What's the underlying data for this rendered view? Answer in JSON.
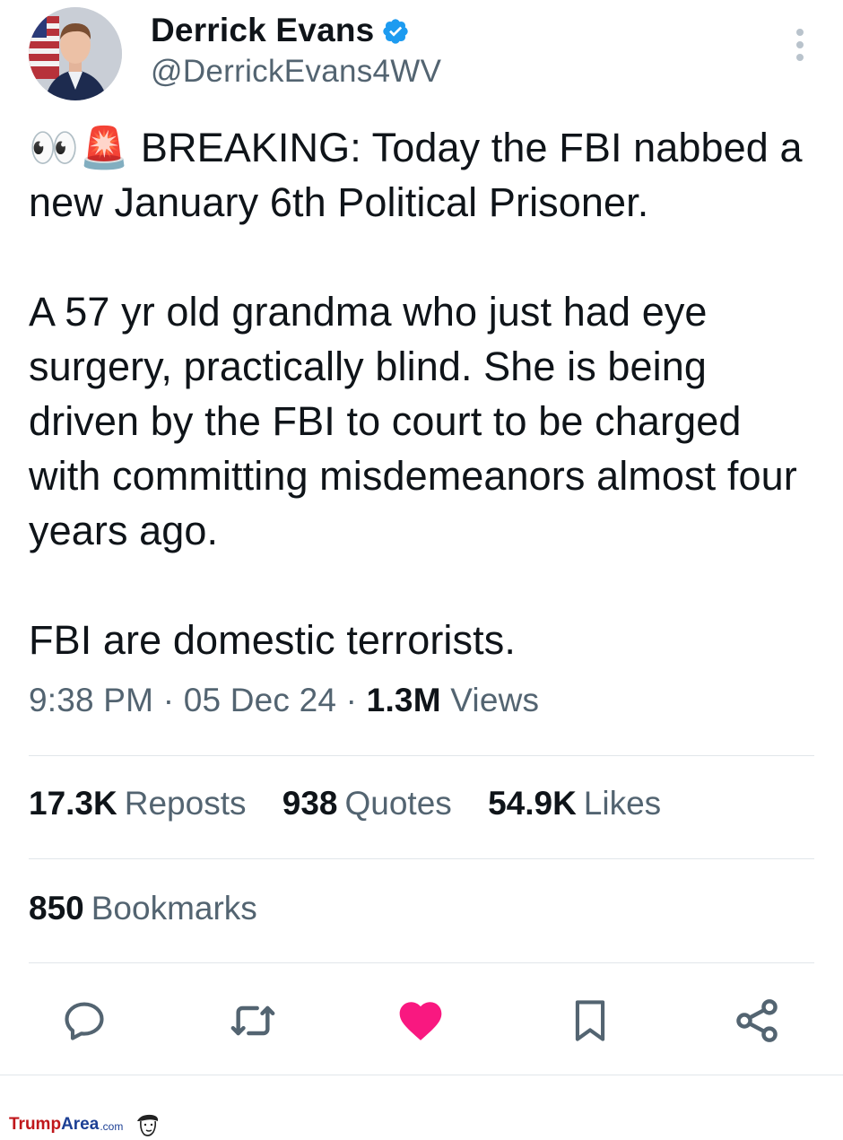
{
  "author": {
    "display_name": "Derrick Evans",
    "handle": "@DerrickEvans4WV",
    "verified": true,
    "verified_color": "#1d9bf0"
  },
  "tweet": {
    "text": "👀🚨 BREAKING: Today the FBI nabbed a new January 6th Political Prisoner.\n\nA 57 yr old grandma who just had eye surgery, practically blind. She is being driven by the FBI to court to be charged with committing misdemeanors almost four years ago.\n\nFBI are domestic terrorists.",
    "time": "9:38 PM",
    "date": "05 Dec 24",
    "views_count": "1.3M",
    "views_label": "Views"
  },
  "stats": {
    "reposts_count": "17.3K",
    "reposts_label": "Reposts",
    "quotes_count": "938",
    "quotes_label": "Quotes",
    "likes_count": "54.9K",
    "likes_label": "Likes",
    "bookmarks_count": "850",
    "bookmarks_label": "Bookmarks"
  },
  "actions": {
    "icons": [
      "reply-icon",
      "repost-icon",
      "like-icon",
      "bookmark-icon",
      "share-icon"
    ],
    "liked": true,
    "like_color": "#f91880",
    "icon_color": "#536471"
  },
  "watermark": {
    "part1": "Trump",
    "part2": "Area",
    "part3": ".com"
  },
  "colors": {
    "text": "#0f1419",
    "secondary": "#536471",
    "divider": "#e1e6ea"
  }
}
